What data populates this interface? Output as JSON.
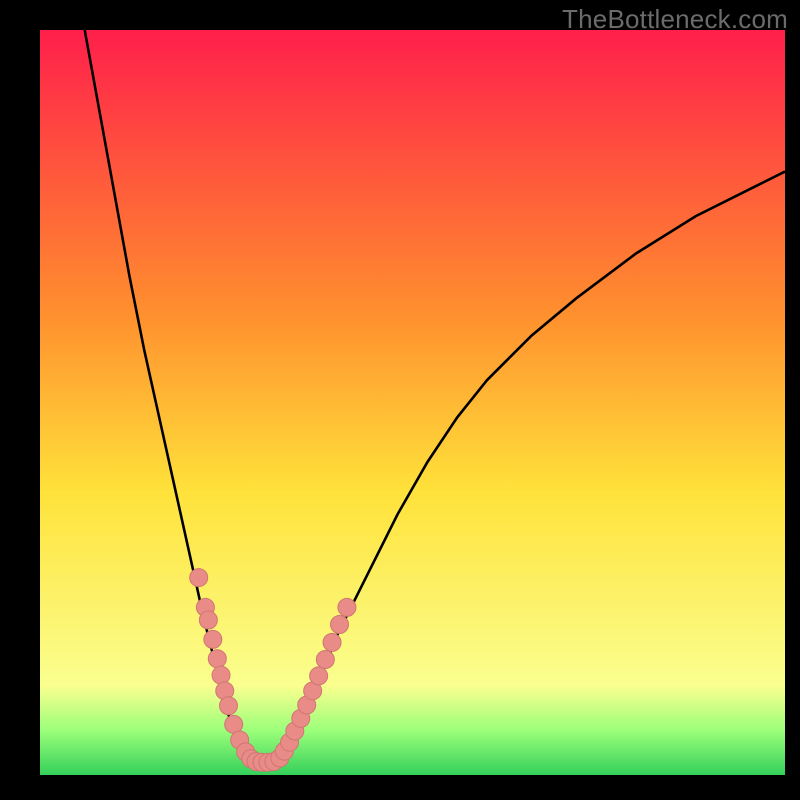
{
  "watermark": "TheBottleneck.com",
  "colors": {
    "gradient_top": "#ff1f4b",
    "gradient_mid_upper": "#ff8f2e",
    "gradient_mid": "#ffe23a",
    "gradient_lower": "#faff8f",
    "gradient_band": "#9cff7a",
    "gradient_bottom": "#34d05b",
    "curve": "#000000",
    "marker_fill": "#e98b87",
    "marker_stroke": "#d07672",
    "frame": "#000000"
  },
  "chart_data": {
    "type": "line",
    "title": "",
    "xlabel": "",
    "ylabel": "",
    "xlim": [
      0,
      100
    ],
    "ylim": [
      0,
      100
    ],
    "curve_left": {
      "x": [
        6,
        8,
        10,
        12,
        14,
        16,
        18,
        20,
        22,
        23,
        24,
        25,
        26,
        27,
        28
      ],
      "y": [
        100,
        89,
        78,
        67,
        57,
        48,
        39,
        30,
        21,
        17,
        13,
        9,
        6,
        3.5,
        2
      ]
    },
    "curve_floor": {
      "x": [
        28,
        29,
        30,
        31,
        32
      ],
      "y": [
        2,
        1.8,
        1.7,
        1.8,
        2
      ]
    },
    "curve_right": {
      "x": [
        32,
        34,
        36,
        38,
        40,
        44,
        48,
        52,
        56,
        60,
        66,
        72,
        80,
        88,
        96,
        100
      ],
      "y": [
        2,
        5,
        9,
        14,
        19,
        27,
        35,
        42,
        48,
        53,
        59,
        64,
        70,
        75,
        79,
        81
      ]
    },
    "series": [
      {
        "name": "markers-left",
        "x": [
          21.3,
          22.2,
          22.6,
          23.2,
          23.8,
          24.3,
          24.8,
          25.3,
          26.0,
          26.8,
          27.6,
          28.3
        ],
        "y": [
          26.5,
          22.5,
          20.8,
          18.2,
          15.6,
          13.4,
          11.3,
          9.3,
          6.8,
          4.7,
          3.1,
          2.2
        ]
      },
      {
        "name": "markers-floor",
        "x": [
          29.0,
          29.8,
          30.6,
          31.4
        ],
        "y": [
          1.8,
          1.7,
          1.7,
          1.8
        ]
      },
      {
        "name": "markers-right",
        "x": [
          32.2,
          32.8,
          33.5,
          34.2,
          35.0,
          35.8,
          36.6,
          37.4,
          38.3,
          39.2,
          40.2,
          41.2
        ],
        "y": [
          2.3,
          3.2,
          4.4,
          5.9,
          7.6,
          9.4,
          11.3,
          13.3,
          15.5,
          17.8,
          20.2,
          22.5
        ]
      }
    ]
  }
}
